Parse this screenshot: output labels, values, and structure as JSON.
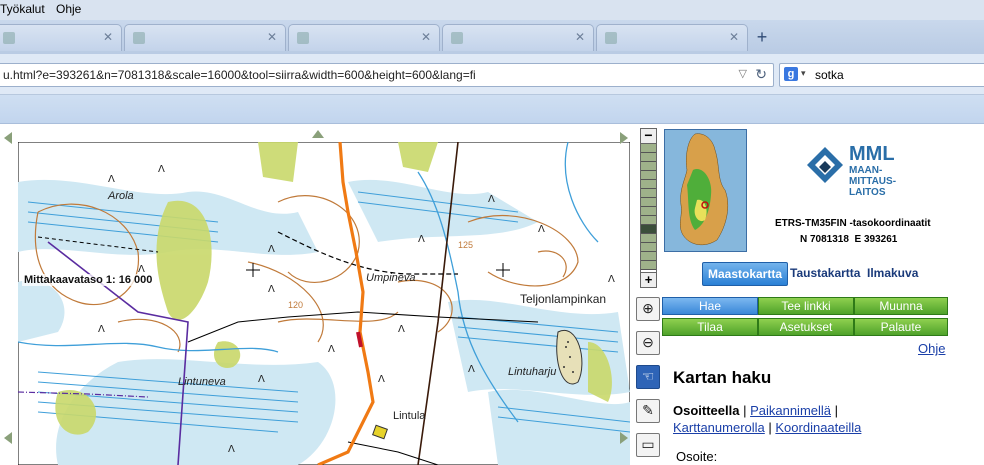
{
  "menu": {
    "tools": "Työkalut",
    "help": "Ohje"
  },
  "browser": {
    "url": "u.html?e=393261&n=7081318&scale=16000&tool=siirra&width=600&height=600&lang=fi",
    "search_value": "sotka",
    "search_engine_icon": "g",
    "new_tab": "+"
  },
  "map": {
    "scale_label": "Mittakaavataso 1: 16 000",
    "place_names": {
      "arola": "Arola",
      "umpineva": "Umpineva",
      "teljonlampinkan": "Teljonlampinkan",
      "lintuneva": "Lintuneva",
      "lintula": "Lintula",
      "lintuharju": "Lintuharju"
    },
    "contour_labels": {
      "c125": "125",
      "c120": "120"
    }
  },
  "zoom": {
    "minus": "−",
    "plus": "+"
  },
  "tools": {
    "zoom_in_icon": "⊕",
    "zoom_out_icon": "⊖",
    "pan_icon": "☜",
    "measure_icon": "✎",
    "ruler_icon": "▭"
  },
  "panel": {
    "logo_text_1": "MML",
    "logo_text_2": "MAAN-",
    "logo_text_3": "MITTAUS-",
    "logo_text_4": "LAITOS",
    "coord_system": "ETRS-TM35FIN -tasokoordinaatit",
    "coord_n": "N 7081318",
    "coord_e": "E 393261",
    "tabs": {
      "maasto": "Maastokartta",
      "tausta": "Taustakartta",
      "ilma": "Ilmakuva"
    },
    "buttons": {
      "hae": "Hae",
      "tee_linkki": "Tee linkki",
      "muunna": "Muunna",
      "tilaa": "Tilaa",
      "asetukset": "Asetukset",
      "palaute": "Palaute"
    },
    "ohje": "Ohje",
    "section_title": "Kartan haku",
    "search": {
      "osoitteella": "Osoitteella",
      "sep1": " | ",
      "paikannimella": "Paikannimellä",
      "sep2": " |",
      "karttanumerolla": "Karttanumerolla",
      "sep3": " | ",
      "koordinaateilla": "Koordinaateilla"
    },
    "osoite_label": "Osoite:"
  },
  "colors": {
    "accent": "#2a80d6",
    "green_button": "#4fa22a",
    "route": "#f07a14",
    "water": "#3f9fd9"
  }
}
